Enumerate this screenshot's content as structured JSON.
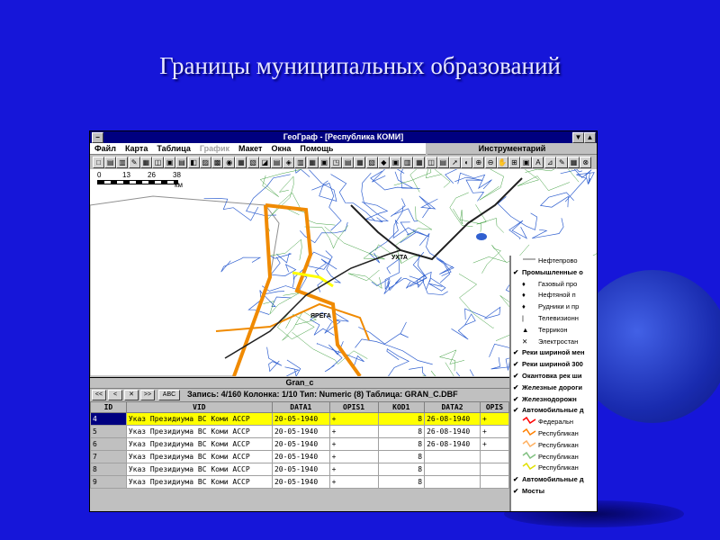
{
  "slide": {
    "title": "Границы муниципальных образований"
  },
  "app": {
    "window_title": "ГеоГраф - [Республика КОМИ]",
    "menu": [
      {
        "label": "Файл",
        "enabled": true
      },
      {
        "label": "Карта",
        "enabled": true
      },
      {
        "label": "Таблица",
        "enabled": true
      },
      {
        "label": "График",
        "enabled": false
      },
      {
        "label": "Макет",
        "enabled": true
      },
      {
        "label": "Окна",
        "enabled": true
      },
      {
        "label": "Помощь",
        "enabled": true
      }
    ],
    "tool_panel_title": "Инструментарий",
    "scale": {
      "ticks": [
        "0",
        "13",
        "26",
        "38"
      ],
      "unit": "км"
    },
    "map_labels": {
      "ukhta": "УХТА",
      "yarega": "ЯРЕГА"
    }
  },
  "legend": {
    "items": [
      {
        "label": "Нефтепрово",
        "checked": false,
        "bold": false,
        "sub": true
      },
      {
        "label": "Промышленные о",
        "checked": true,
        "bold": true,
        "sub": false
      },
      {
        "label": "Газовый про",
        "checked": false,
        "bold": false,
        "sub": true,
        "symbol": "♦"
      },
      {
        "label": "Нефтяной п",
        "checked": false,
        "bold": false,
        "sub": true,
        "symbol": "♦"
      },
      {
        "label": "Рудники и пр",
        "checked": false,
        "bold": false,
        "sub": true,
        "symbol": "♦"
      },
      {
        "label": "Телевизионн",
        "checked": false,
        "bold": false,
        "sub": true,
        "symbol": "|"
      },
      {
        "label": "Террикон",
        "checked": false,
        "bold": false,
        "sub": true,
        "symbol": "▲"
      },
      {
        "label": "Электростан",
        "checked": false,
        "bold": false,
        "sub": true,
        "symbol": "✕"
      },
      {
        "label": "Реки шириной мен",
        "checked": true,
        "bold": true,
        "sub": false
      },
      {
        "label": "Реки шириной 300",
        "checked": true,
        "bold": true,
        "sub": false
      },
      {
        "label": "Окантовка рек ши",
        "checked": true,
        "bold": true,
        "sub": false
      },
      {
        "label": "Железные дороги",
        "checked": true,
        "bold": true,
        "sub": false
      },
      {
        "label": "Железнодорожн",
        "checked": true,
        "bold": true,
        "sub": false
      },
      {
        "label": "Автомобильные д",
        "checked": true,
        "bold": true,
        "sub": false
      },
      {
        "label": "Федеральн",
        "checked": false,
        "bold": false,
        "sub": true,
        "color": "#ff0000"
      },
      {
        "label": "Республикан",
        "checked": false,
        "bold": false,
        "sub": true,
        "color": "#ff8000"
      },
      {
        "label": "Республикан",
        "checked": false,
        "bold": false,
        "sub": true,
        "color": "#ffb060"
      },
      {
        "label": "Республикан",
        "checked": false,
        "bold": false,
        "sub": true,
        "color": "#80c080"
      },
      {
        "label": "Республикан",
        "checked": false,
        "bold": false,
        "sub": true,
        "color": "#e0e000"
      },
      {
        "label": "Автомобильные д",
        "checked": true,
        "bold": true,
        "sub": false
      },
      {
        "label": "Мосты",
        "checked": true,
        "bold": true,
        "sub": false
      }
    ]
  },
  "table": {
    "window_title": "Gran_c",
    "nav": [
      "<<",
      "<",
      "✕",
      ">>",
      "ABC"
    ],
    "status": "Запись: 4/160  Колонка: 1/10  Тип: Numeric (8)  Таблица: GRAN_C.DBF",
    "columns": [
      "ID",
      "VID",
      "DATA1",
      "OPIS1",
      "KOD1",
      "DATA2",
      "OPIS"
    ],
    "rows": [
      {
        "n": "4",
        "vid": "Указ Президиума ВС Коми АССР",
        "data1": "20-05-1940",
        "opis1": "+",
        "kod1": "8",
        "data2": "26-08-1940",
        "opis": "+",
        "selected": true
      },
      {
        "n": "5",
        "vid": "Указ Президиума ВС Коми АССР",
        "data1": "20-05-1940",
        "opis1": "+",
        "kod1": "8",
        "data2": "26-08-1940",
        "opis": "+",
        "selected": false
      },
      {
        "n": "6",
        "vid": "Указ Президиума ВС Коми АССР",
        "data1": "20-05-1940",
        "opis1": "+",
        "kod1": "8",
        "data2": "26-08-1940",
        "opis": "+",
        "selected": false
      },
      {
        "n": "7",
        "vid": "Указ Президиума ВС Коми АССР",
        "data1": "20-05-1940",
        "opis1": "+",
        "kod1": "8",
        "data2": "",
        "opis": "",
        "selected": false
      },
      {
        "n": "8",
        "vid": "Указ Президиума ВС Коми АССР",
        "data1": "20-05-1940",
        "opis1": "+",
        "kod1": "8",
        "data2": "",
        "opis": "",
        "selected": false
      },
      {
        "n": "9",
        "vid": "Указ Президиума ВС Коми АССР",
        "data1": "20-05-1940",
        "opis1": "+",
        "kod1": "8",
        "data2": "",
        "opis": "",
        "selected": false
      }
    ]
  }
}
